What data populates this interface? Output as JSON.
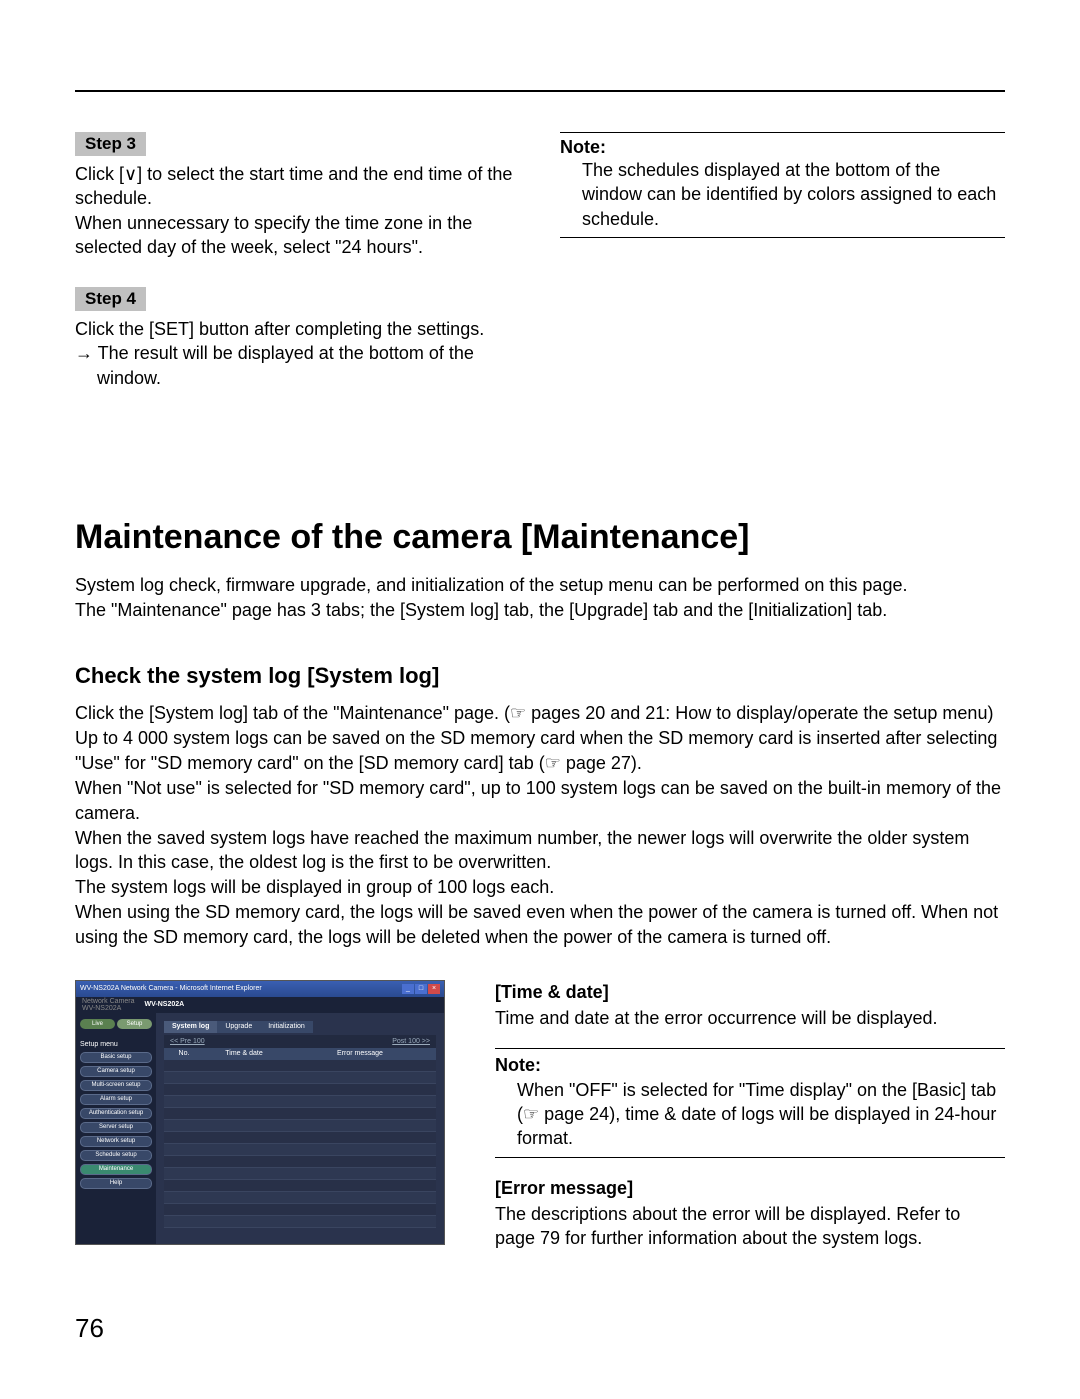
{
  "top": {
    "step3_label": "Step 3",
    "step3_line1": "Click [∨] to select the start time and the end time of the schedule.",
    "step3_line2": "When unnecessary to specify the time zone in the selected day of the week, select \"24 hours\".",
    "step4_label": "Step 4",
    "step4_line1": "Click the [SET] button after completing the settings.",
    "step4_line2": "→ The result will be displayed at the bottom of the window.",
    "note_label": "Note:",
    "note_body": "The schedules displayed at the bottom of the window can be identified by colors assigned to each schedule."
  },
  "main": {
    "heading": "Maintenance of the camera [Maintenance]",
    "intro": "System log check, firmware upgrade, and initialization of the setup menu can be performed on this page.\nThe \"Maintenance\" page has 3 tabs; the [System log] tab, the [Upgrade] tab and the [Initialization] tab.",
    "sub_heading": "Check the system log [System log]",
    "syslog_body": "Click the [System log] tab of the \"Maintenance\" page. (☞ pages 20 and 21: How to display/operate the setup menu)\nUp to 4 000 system logs can be saved on the SD memory card when the SD memory card is inserted after selecting \"Use\" for \"SD memory card\" on the [SD memory card] tab (☞ page 27).\nWhen \"Not use\" is selected for \"SD memory card\", up to 100 system logs can be saved on the built-in memory of the camera.\nWhen the saved system logs have reached the maximum number, the newer logs will overwrite the older system logs. In this case, the oldest log is the first to be overwritten.\nThe system logs will be displayed in group of 100 logs each.\nWhen using the SD memory card, the logs will be saved even when the power of the camera is turned off. When not using the SD memory card, the logs will be deleted when the power of the camera is turned off."
  },
  "screenshot": {
    "window_title": "WV-NS202A Network Camera - Microsoft Internet Explorer",
    "model_left": "Network Camera",
    "model_left2": "WV-NS202A",
    "model_right": "WV-NS202A",
    "live": "Live",
    "setup": "Setup",
    "menu_label": "Setup menu",
    "menu": [
      "Basic setup",
      "Camera setup",
      "Multi-screen setup",
      "Alarm setup",
      "Authentication setup",
      "Server setup",
      "Network setup",
      "Schedule setup",
      "Maintenance",
      "Help"
    ],
    "tabs": [
      "System log",
      "Upgrade",
      "Initialization"
    ],
    "prev": "<< Pre 100",
    "next": "Post 100 >>",
    "th_no": "No.",
    "th_td": "Time & date",
    "th_em": "Error message"
  },
  "fields": {
    "td_title": "[Time & date]",
    "td_text": "Time and date at the error occurrence will be displayed.",
    "note_label": "Note:",
    "note_body": "When \"OFF\" is selected for \"Time display\" on the [Basic] tab (☞ page 24), time & date of logs will be displayed in 24-hour format.",
    "em_title": "[Error message]",
    "em_text": "The descriptions about the error will be displayed. Refer to page 79 for further information about the system logs."
  },
  "page_number": "76"
}
